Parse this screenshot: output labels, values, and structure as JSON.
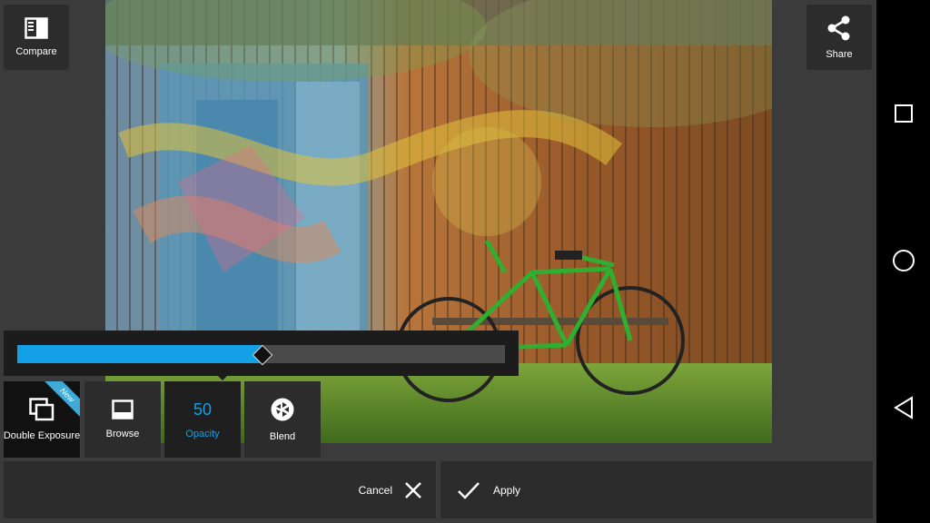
{
  "toolbar": {
    "compare_label": "Compare",
    "share_label": "Share"
  },
  "opacity": {
    "value": "50",
    "slider_fraction": 0.5
  },
  "tools": [
    {
      "label": "Double Exposure",
      "badge": "New",
      "icon": "double-exposure-icon"
    },
    {
      "label": "Browse",
      "icon": "browse-icon"
    },
    {
      "label": "Opacity",
      "icon": "none"
    },
    {
      "label": "Blend",
      "icon": "aperture-icon"
    }
  ],
  "actions": {
    "cancel_label": "Cancel",
    "apply_label": "Apply"
  },
  "colors": {
    "accent": "#14a0e6",
    "panel": "#2c2c2c",
    "background": "#3b3b3b"
  },
  "navbar": {
    "buttons": [
      "recent-apps-icon",
      "home-icon",
      "back-icon"
    ]
  }
}
